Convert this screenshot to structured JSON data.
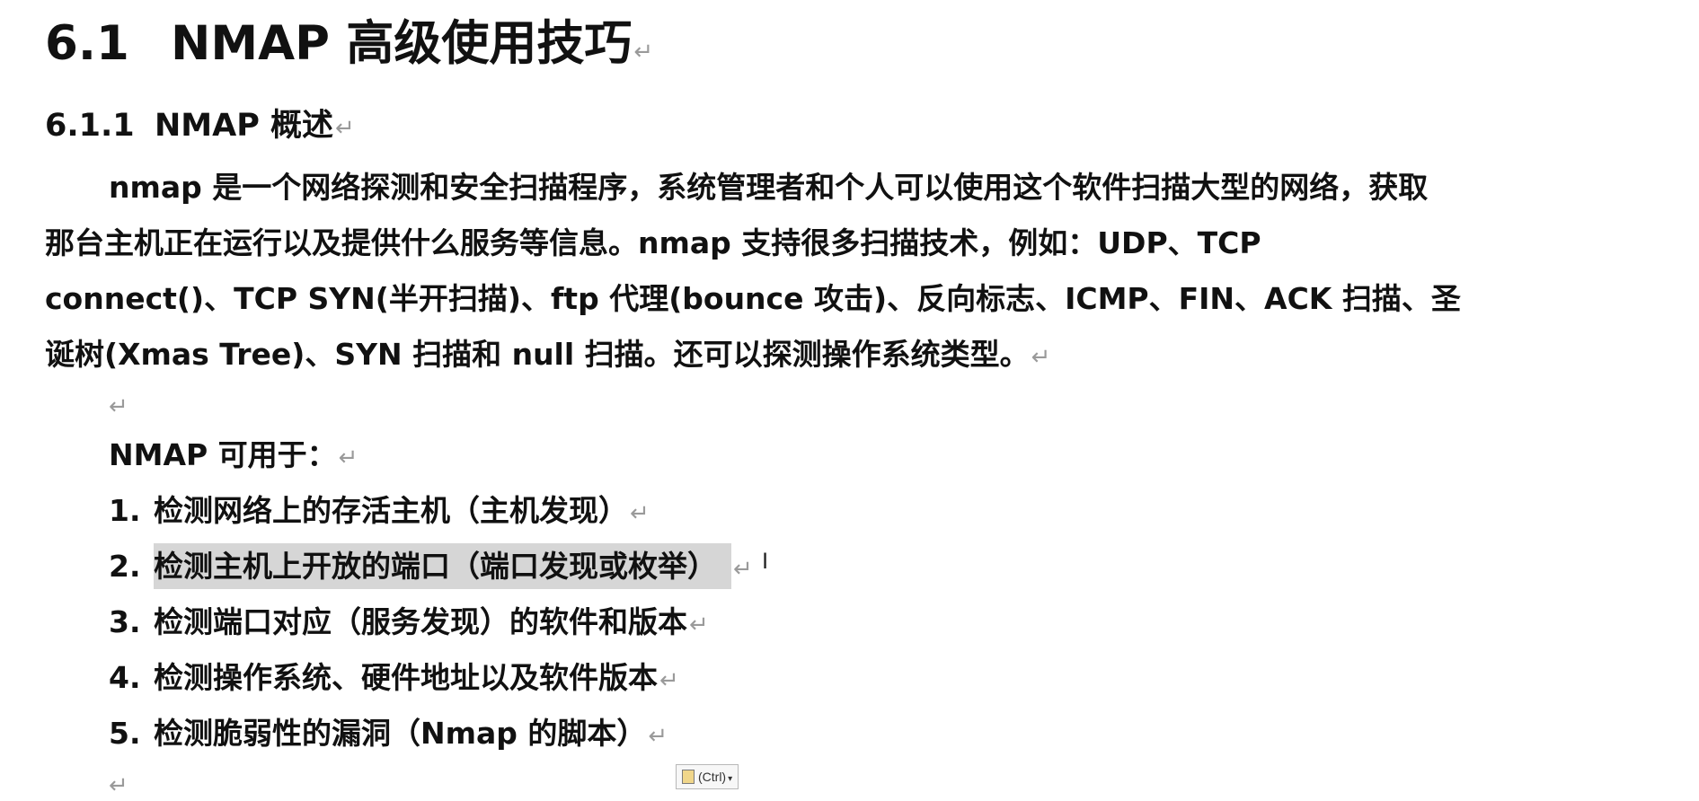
{
  "heading1": {
    "number": "6.1",
    "title": "NMAP 高级使用技巧"
  },
  "heading2": {
    "number": "6.1.1",
    "title": "NMAP 概述"
  },
  "paragraph": {
    "lines": [
      "nmap 是一个网络探测和安全扫描程序，系统管理者和个人可以使用这个软件扫描大型的网络，获取",
      "那台主机正在运行以及提供什么服务等信息。nmap 支持很多扫描技术，例如：UDP、TCP",
      "connect()、TCP SYN(半开扫描)、ftp 代理(bounce 攻击)、反向标志、ICMP、FIN、ACK 扫描、圣",
      "诞树(Xmas Tree)、SYN 扫描和 null 扫描。还可以探测操作系统类型。"
    ]
  },
  "paragraph_mark": "↵",
  "uses": {
    "title": "NMAP 可用于：",
    "items": [
      {
        "index": "1.",
        "text": "检测网络上的存活主机（主机发现）"
      },
      {
        "index": "2.",
        "text": "检测主机上开放的端口（端口发现或枚举）"
      },
      {
        "index": "3.",
        "text": "检测端口对应（服务发现）的软件和版本"
      },
      {
        "index": "4.",
        "text": "检测操作系统、硬件地址以及软件版本"
      },
      {
        "index": "5.",
        "text": "检测脆弱性的漏洞（Nmap 的脚本）"
      }
    ]
  },
  "paste_options": {
    "label": "(Ctrl)",
    "icon": "clipboard-icon"
  },
  "colors": {
    "text": "#111111",
    "selection": "#d6d6d6",
    "paragraph_mark": "#9a9a9a"
  }
}
